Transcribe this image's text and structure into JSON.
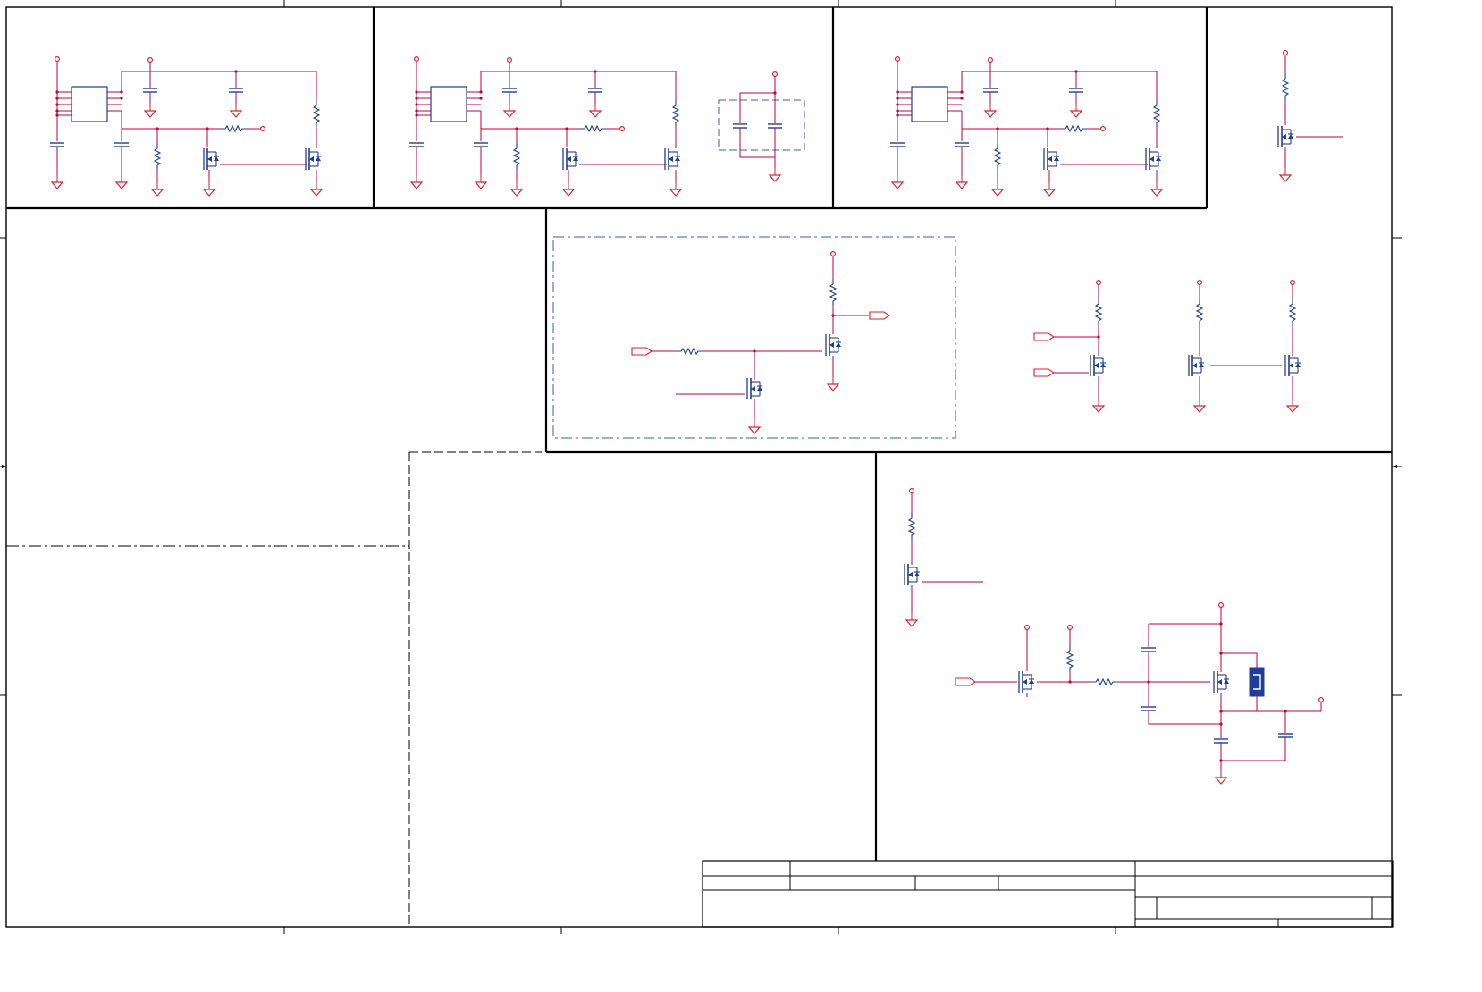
{
  "sheet": {
    "title": "",
    "colors": {
      "wire": "#c0003a",
      "power": "#e0202a",
      "component": "#1f3d99",
      "border": "#000000",
      "dashed_box": "#3a5cc0"
    }
  },
  "title_block": {
    "company": "",
    "title": "",
    "document_number": "",
    "revision": "",
    "date": "",
    "sheet": ""
  }
}
